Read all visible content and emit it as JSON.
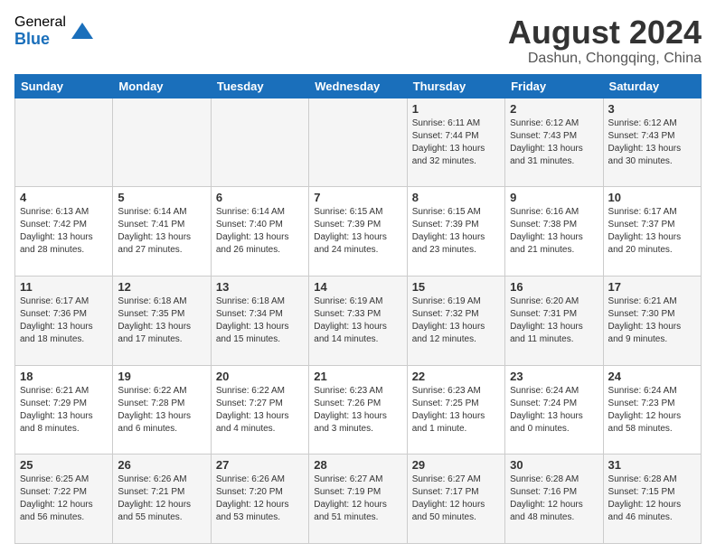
{
  "logo": {
    "general": "General",
    "blue": "Blue"
  },
  "title": "August 2024",
  "location": "Dashun, Chongqing, China",
  "days_of_week": [
    "Sunday",
    "Monday",
    "Tuesday",
    "Wednesday",
    "Thursday",
    "Friday",
    "Saturday"
  ],
  "weeks": [
    [
      {
        "day": "",
        "info": ""
      },
      {
        "day": "",
        "info": ""
      },
      {
        "day": "",
        "info": ""
      },
      {
        "day": "",
        "info": ""
      },
      {
        "day": "1",
        "info": "Sunrise: 6:11 AM\nSunset: 7:44 PM\nDaylight: 13 hours\nand 32 minutes."
      },
      {
        "day": "2",
        "info": "Sunrise: 6:12 AM\nSunset: 7:43 PM\nDaylight: 13 hours\nand 31 minutes."
      },
      {
        "day": "3",
        "info": "Sunrise: 6:12 AM\nSunset: 7:43 PM\nDaylight: 13 hours\nand 30 minutes."
      }
    ],
    [
      {
        "day": "4",
        "info": "Sunrise: 6:13 AM\nSunset: 7:42 PM\nDaylight: 13 hours\nand 28 minutes."
      },
      {
        "day": "5",
        "info": "Sunrise: 6:14 AM\nSunset: 7:41 PM\nDaylight: 13 hours\nand 27 minutes."
      },
      {
        "day": "6",
        "info": "Sunrise: 6:14 AM\nSunset: 7:40 PM\nDaylight: 13 hours\nand 26 minutes."
      },
      {
        "day": "7",
        "info": "Sunrise: 6:15 AM\nSunset: 7:39 PM\nDaylight: 13 hours\nand 24 minutes."
      },
      {
        "day": "8",
        "info": "Sunrise: 6:15 AM\nSunset: 7:39 PM\nDaylight: 13 hours\nand 23 minutes."
      },
      {
        "day": "9",
        "info": "Sunrise: 6:16 AM\nSunset: 7:38 PM\nDaylight: 13 hours\nand 21 minutes."
      },
      {
        "day": "10",
        "info": "Sunrise: 6:17 AM\nSunset: 7:37 PM\nDaylight: 13 hours\nand 20 minutes."
      }
    ],
    [
      {
        "day": "11",
        "info": "Sunrise: 6:17 AM\nSunset: 7:36 PM\nDaylight: 13 hours\nand 18 minutes."
      },
      {
        "day": "12",
        "info": "Sunrise: 6:18 AM\nSunset: 7:35 PM\nDaylight: 13 hours\nand 17 minutes."
      },
      {
        "day": "13",
        "info": "Sunrise: 6:18 AM\nSunset: 7:34 PM\nDaylight: 13 hours\nand 15 minutes."
      },
      {
        "day": "14",
        "info": "Sunrise: 6:19 AM\nSunset: 7:33 PM\nDaylight: 13 hours\nand 14 minutes."
      },
      {
        "day": "15",
        "info": "Sunrise: 6:19 AM\nSunset: 7:32 PM\nDaylight: 13 hours\nand 12 minutes."
      },
      {
        "day": "16",
        "info": "Sunrise: 6:20 AM\nSunset: 7:31 PM\nDaylight: 13 hours\nand 11 minutes."
      },
      {
        "day": "17",
        "info": "Sunrise: 6:21 AM\nSunset: 7:30 PM\nDaylight: 13 hours\nand 9 minutes."
      }
    ],
    [
      {
        "day": "18",
        "info": "Sunrise: 6:21 AM\nSunset: 7:29 PM\nDaylight: 13 hours\nand 8 minutes."
      },
      {
        "day": "19",
        "info": "Sunrise: 6:22 AM\nSunset: 7:28 PM\nDaylight: 13 hours\nand 6 minutes."
      },
      {
        "day": "20",
        "info": "Sunrise: 6:22 AM\nSunset: 7:27 PM\nDaylight: 13 hours\nand 4 minutes."
      },
      {
        "day": "21",
        "info": "Sunrise: 6:23 AM\nSunset: 7:26 PM\nDaylight: 13 hours\nand 3 minutes."
      },
      {
        "day": "22",
        "info": "Sunrise: 6:23 AM\nSunset: 7:25 PM\nDaylight: 13 hours\nand 1 minute."
      },
      {
        "day": "23",
        "info": "Sunrise: 6:24 AM\nSunset: 7:24 PM\nDaylight: 13 hours\nand 0 minutes."
      },
      {
        "day": "24",
        "info": "Sunrise: 6:24 AM\nSunset: 7:23 PM\nDaylight: 12 hours\nand 58 minutes."
      }
    ],
    [
      {
        "day": "25",
        "info": "Sunrise: 6:25 AM\nSunset: 7:22 PM\nDaylight: 12 hours\nand 56 minutes."
      },
      {
        "day": "26",
        "info": "Sunrise: 6:26 AM\nSunset: 7:21 PM\nDaylight: 12 hours\nand 55 minutes."
      },
      {
        "day": "27",
        "info": "Sunrise: 6:26 AM\nSunset: 7:20 PM\nDaylight: 12 hours\nand 53 minutes."
      },
      {
        "day": "28",
        "info": "Sunrise: 6:27 AM\nSunset: 7:19 PM\nDaylight: 12 hours\nand 51 minutes."
      },
      {
        "day": "29",
        "info": "Sunrise: 6:27 AM\nSunset: 7:17 PM\nDaylight: 12 hours\nand 50 minutes."
      },
      {
        "day": "30",
        "info": "Sunrise: 6:28 AM\nSunset: 7:16 PM\nDaylight: 12 hours\nand 48 minutes."
      },
      {
        "day": "31",
        "info": "Sunrise: 6:28 AM\nSunset: 7:15 PM\nDaylight: 12 hours\nand 46 minutes."
      }
    ]
  ]
}
